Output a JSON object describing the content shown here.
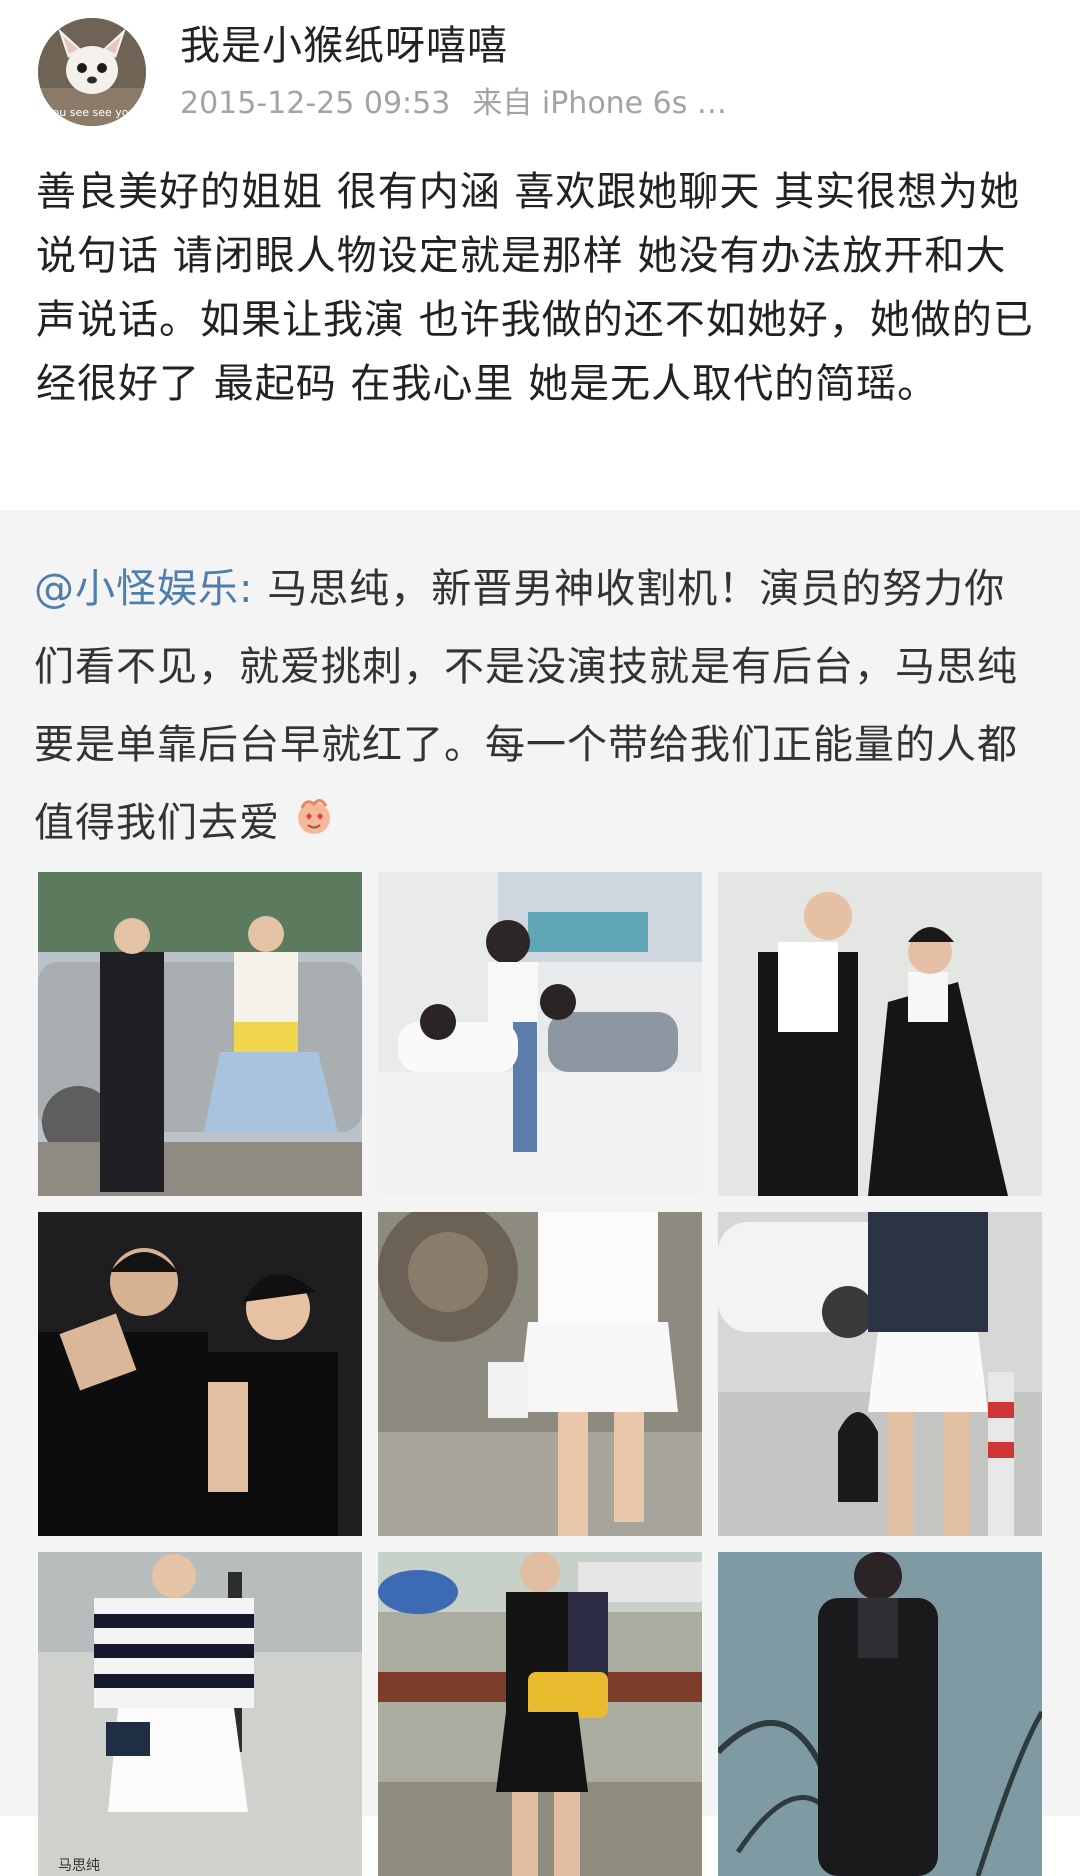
{
  "post": {
    "author": {
      "username": "我是小猴纸呀嘻嘻",
      "avatar_icon": "chihuahua-avatar"
    },
    "timestamp": "2015-12-25 09:53",
    "source": "来自 iPhone 6s …",
    "text": "善良美好的姐姐 很有内涵 喜欢跟她聊天 其实很想为她说句话 请闭眼人物设定就是那样 她没有办法放开和大声说话。如果让我演 也许我做的还不如她好，她做的已经很好了 最起码 在我心里 她是无人取代的简瑶。"
  },
  "repost": {
    "mention": "@小怪娱乐:",
    "text": " 马思纯，新晋男神收割机！演员的努力你们看不见，就爱挑刺，不是没演技就是有后台，马思纯要是单靠后台早就红了。每一个带给我们正能量的人都值得我们去爱",
    "emoji_icon": "heart-eyes-emoji",
    "images": [
      {
        "icon": "photo-couple-by-car"
      },
      {
        "icon": "photo-couple-on-floor"
      },
      {
        "icon": "photo-couple-studio"
      },
      {
        "icon": "photo-couple-close-up"
      },
      {
        "icon": "photo-legs-white-skirt"
      },
      {
        "icon": "photo-street-denim-jacket"
      },
      {
        "icon": "photo-striped-top"
      },
      {
        "icon": "photo-yellow-bag"
      },
      {
        "icon": "photo-dark-coat"
      }
    ],
    "image_caption": "马思纯"
  },
  "colors": {
    "mention": "#4f7dac",
    "meta_text": "#a3a3a3",
    "repost_background": "#f4f4f4"
  }
}
